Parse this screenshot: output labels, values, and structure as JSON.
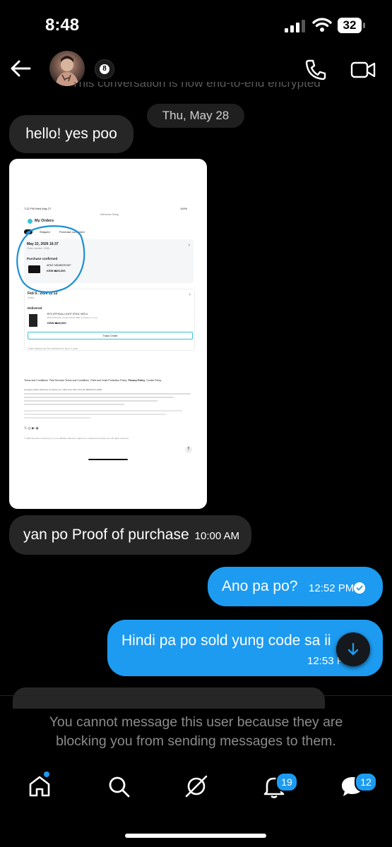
{
  "status_bar": {
    "time": "8:48",
    "battery": "32"
  },
  "header": {
    "encrypted_notice": "This conversation is now end-to-end encrypted"
  },
  "date_chip": "Thu, May 28",
  "messages": [
    {
      "text": "hello! yes poo"
    },
    {
      "text": "yan po Proof of purchase",
      "time": "10:00 AM"
    },
    {
      "text": "Ano pa po?",
      "time": "12:52 PM"
    },
    {
      "text": "Hindi pa po sold yung code sa ii",
      "time": "12:53 PM"
    }
  ],
  "attachment": {
    "status_time": "7:22 PM  Wed May 27",
    "site": "Weverse Shop",
    "battery": "100%",
    "title": "My Orders",
    "tabs": [
      "All",
      "Shipped",
      "Purchase confirmed"
    ],
    "order1": {
      "date": "May 22, 2026 16:37",
      "number": "Order number: 2186...",
      "status": "Purchase confirmed",
      "item": "ARMY MEMBERSHIP",
      "price": "KRW ₩25,000"
    },
    "order2": {
      "date": "Feb 0.. 2026 12:12",
      "number": "Order...",
      "status": "Delivered",
      "item": "BTS OFFICIAL LIGHT STICK VER.4",
      "item_sub": "BTS OFFICIAL LIGHT STICK VER.4 / Poster 1 | 1 ea",
      "price": "KRW ₩49,000",
      "track": "Track Order"
    },
    "history_note": "Order history can be reviewed for up to 1 year",
    "footer_links": [
      "Terms and Conditions",
      "Paid Services Terms and Conditions",
      "Child and Youth Protection Policy",
      "Privacy Policy",
      "Cookie Policy"
    ],
    "company": "Company Name  Weverse Company Inc.   CEO  Joon Won Choi   Tel  (82)30-270-1500",
    "copyright": "© 2026 Weverse Company Inc. or its affiliates (Weverse Japan Inc. & Weverse America Inc.) All rights reserved."
  },
  "blocked_notice": "You cannot message this user because they are blocking you from sending messages to them.",
  "nav": {
    "notifications_badge": "19",
    "messages_badge": "12"
  },
  "colors": {
    "accent": "#1d9bf0",
    "bubble_in": "#262626"
  }
}
